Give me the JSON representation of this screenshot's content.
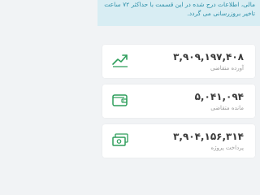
{
  "notice": {
    "text": "مالی، اطلاعات درج شده در این قسمت با حداکثر ۷۲ ساعت تاخیر بروزرسانی می گردد."
  },
  "cards": [
    {
      "amount": "۳,۹۰۹,۱۹۷,۴۰۸",
      "label": "آورده متقاضی",
      "icon": "growth-chart-icon"
    },
    {
      "amount": "۵,۰۴۱,۰۹۴",
      "label": "مانده متقاضی",
      "icon": "wallet-icon"
    },
    {
      "amount": "۳,۹۰۴,۱۵۶,۳۱۴",
      "label": "پرداخت پروژه",
      "icon": "banknotes-icon"
    }
  ],
  "colors": {
    "notice_bg": "#d8edf3",
    "notice_text": "#2b8fa8",
    "icon_green": "#2e9e5b",
    "amount_text": "#3b3b3b",
    "label_text": "#9a9a9a"
  }
}
